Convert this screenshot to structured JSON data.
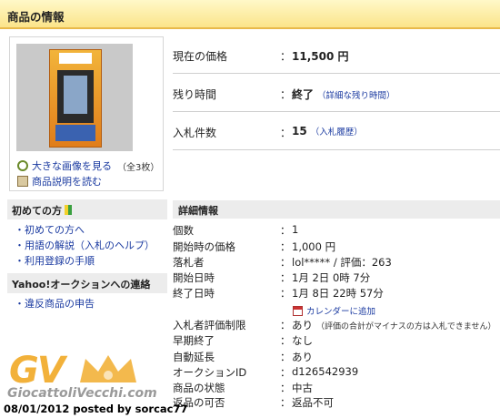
{
  "header": {
    "title": "商品の情報"
  },
  "gallery": {
    "enlarge_link": "大きな画像を見る",
    "count": "（全3枚）",
    "description_link": "商品説明を読む"
  },
  "sidebar": {
    "beginner": {
      "title": "初めての方",
      "links": [
        "初めての方へ",
        "用語の解説（入札のヘルプ）",
        "利用登録の手順"
      ]
    },
    "contact": {
      "title": "Yahoo!オークションへの連絡",
      "links": [
        "違反商品の申告"
      ]
    }
  },
  "summary": {
    "current_price_label": "現在の価格",
    "current_price": "11,500 円",
    "remaining_label": "残り時間",
    "remaining": "終了",
    "remaining_link": "（詳細な残り時間）",
    "bids_label": "入札件数",
    "bids": "15",
    "bids_link": "（入札履歴）"
  },
  "details": {
    "title": "詳細情報",
    "rows": [
      {
        "label": "個数",
        "value": "1"
      },
      {
        "label": "開始時の価格",
        "value": "1,000 円"
      },
      {
        "label": "落札者",
        "value": "lol***** / 評価：263"
      },
      {
        "label": "開始日時",
        "value": "1月 2日 0時 7分"
      },
      {
        "label": "終了日時",
        "value": "1月 8日 22時 57分"
      },
      {
        "label": "入札者評価制限",
        "value": "あり",
        "note": "（評価の合計がマイナスの方は入札できません）"
      },
      {
        "label": "早期終了",
        "value": "なし"
      },
      {
        "label": "自動延長",
        "value": "あり"
      },
      {
        "label": "オークションID",
        "value": "d126542939"
      },
      {
        "label": "商品の状態",
        "value": "中古"
      },
      {
        "label": "返品の可否",
        "value": "返品不可"
      }
    ],
    "calendar_link": "カレンダーに追加"
  },
  "watermark": {
    "logo": "GV",
    "site": "GiocattoliVecchi.com",
    "posted": "08/01/2012 posted by sorcac77"
  },
  "colors": {
    "header_bg": "#fbe48a",
    "link": "#1a3aa0",
    "logo": "#f2b13a"
  }
}
